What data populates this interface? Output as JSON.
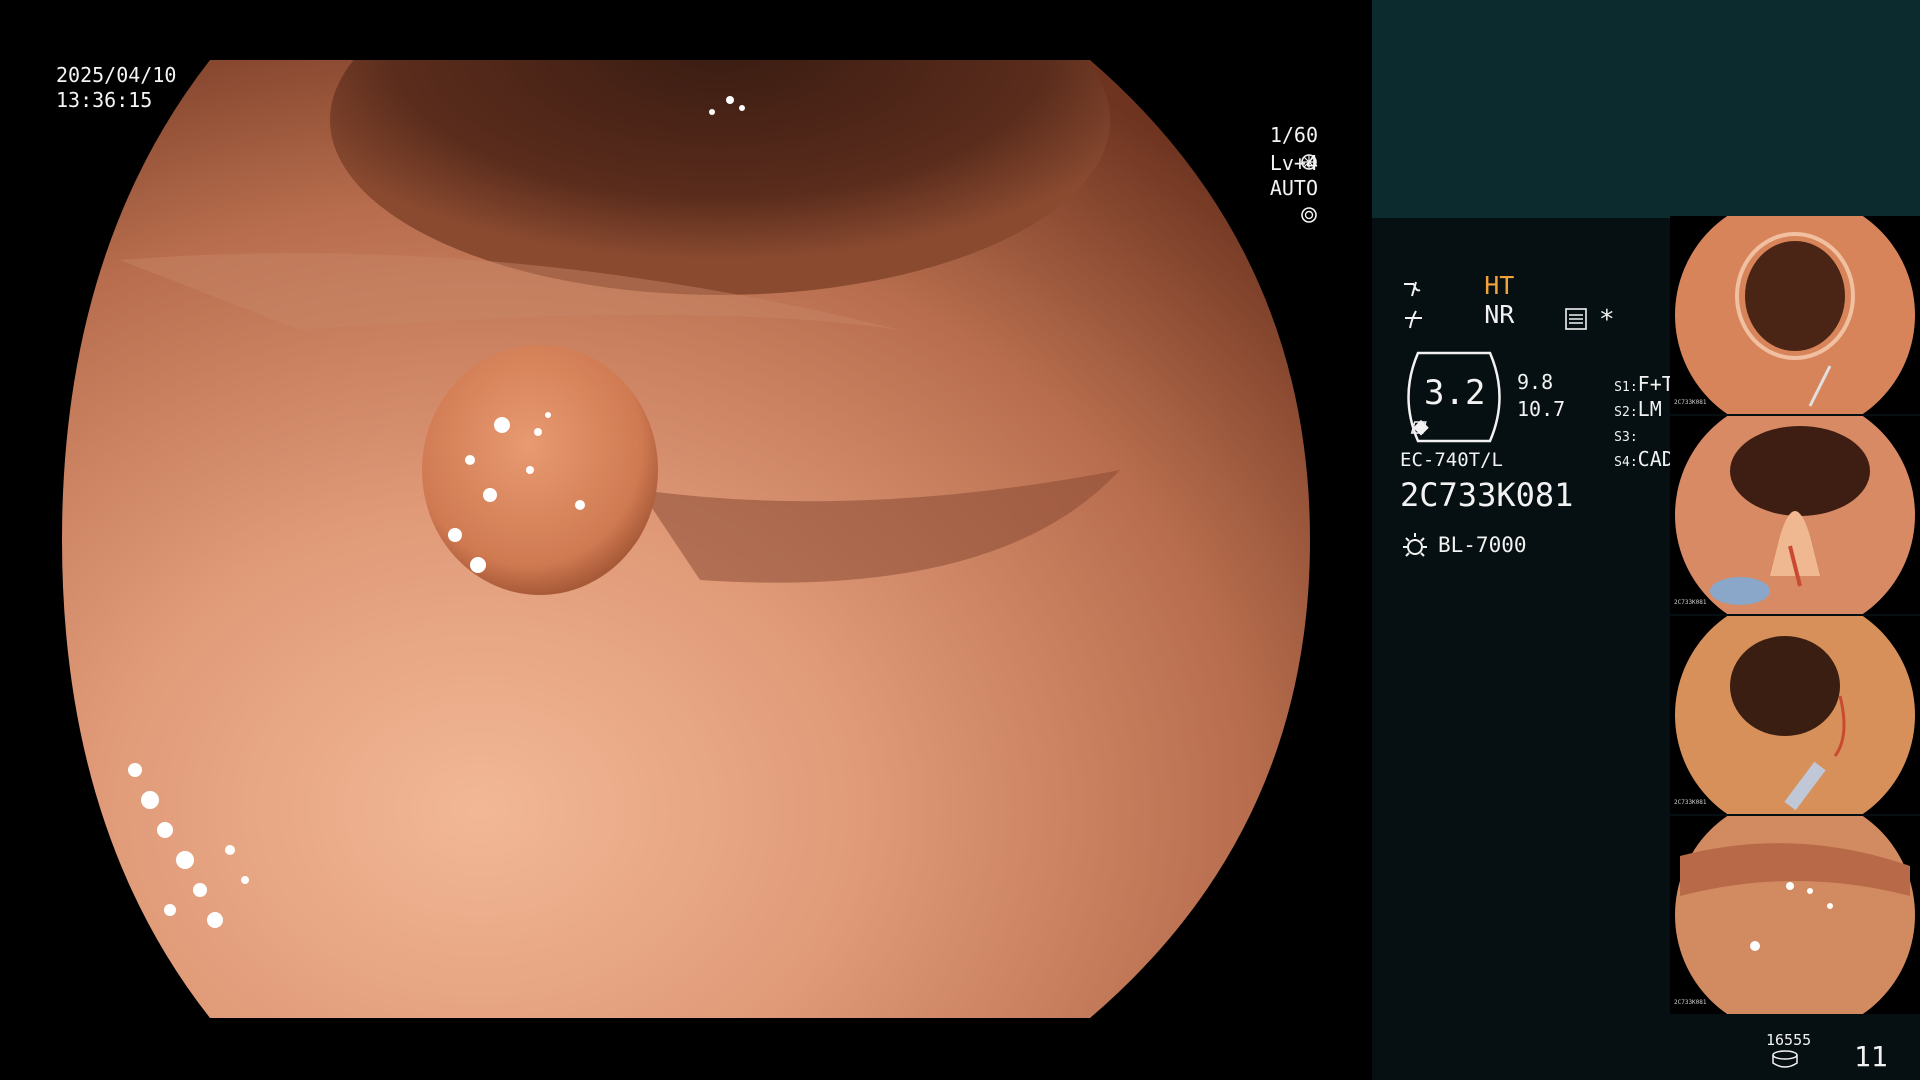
{
  "main": {
    "date": "2025/04/10",
    "time": "13:36:15",
    "shutter": "1/60",
    "level": "Lv+4",
    "mode": "AUTO",
    "icons": [
      "shutter-icon",
      "iris-icon"
    ]
  },
  "side": {
    "ht_label": "HT",
    "nr_label": "NR",
    "menu_icon_symbol": "*",
    "zoom_value": "3.2",
    "value_top": "9.8",
    "value_bottom": "10.7",
    "s1_key": "S1:",
    "s1_val": "F+T",
    "s2_key": "S2:",
    "s2_val": "LM",
    "s3_key": "S3:",
    "s3_val": "",
    "s4_key": "S4:",
    "s4_val": "CAD",
    "scope_model": "EC-740T/L",
    "serial": "2C733K081",
    "light_source": "BL-7000",
    "storage_count": "16555",
    "image_count": "11",
    "accent_color": "#f2a23a",
    "panel_color": "#0c2b2e",
    "icons": [
      "wave-icon",
      "slash-wave-icon",
      "settings-menu-icon",
      "light-source-icon",
      "storage-icon"
    ]
  },
  "thumbnails": [
    {
      "label": "2C733K081"
    },
    {
      "label": "2C733K081"
    },
    {
      "label": "2C733K081"
    },
    {
      "label": "2C733K081"
    }
  ]
}
